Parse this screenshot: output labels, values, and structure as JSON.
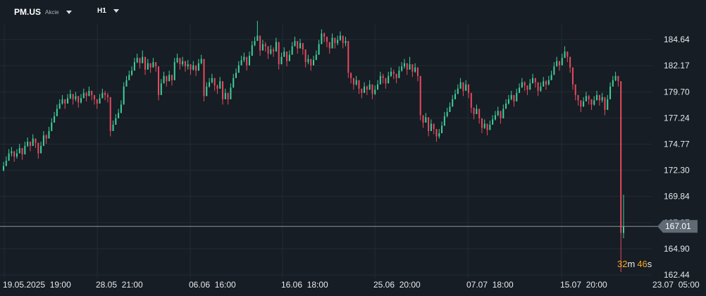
{
  "toolbar": {
    "symbol": "PM.US",
    "asset_class": "Akcie",
    "timeframe": "H1"
  },
  "countdown": {
    "minutes": "32",
    "m_unit": "m",
    "seconds": "46",
    "s_unit": "s"
  },
  "colors": {
    "background": "#161d24",
    "grid": "#222b34",
    "up_candle": "#3fcf9a",
    "down_candle": "#e8495f",
    "price_line": "#8a949e",
    "price_tag": "#606a74",
    "countdown": "#f5a623"
  },
  "chart_data": {
    "type": "candlestick",
    "y_ticks": [
      "184.64",
      "182.17",
      "179.70",
      "177.24",
      "174.77",
      "172.30",
      "169.84",
      "167.37",
      "164.90",
      "162.44"
    ],
    "y_range": [
      162.44,
      184.64
    ],
    "x_ticks": [
      "19.05.2025  19:00",
      "28.05  21:00",
      "06.06  16:00",
      "16.06  18:00",
      "25.06  20:00",
      "07.07  18:00",
      "15.07  20:00",
      "23.07  05:00"
    ],
    "current_price": "167.01",
    "grid": true,
    "closes": [
      172.7,
      173.2,
      173.9,
      174.1,
      173.6,
      173.9,
      174.4,
      173.8,
      174.6,
      175.0,
      174.6,
      175.3,
      174.9,
      173.9,
      174.6,
      175.6,
      175.3,
      176.0,
      176.8,
      177.4,
      178.1,
      178.6,
      179.0,
      178.6,
      179.1,
      179.5,
      179.0,
      179.3,
      178.7,
      179.1,
      179.6,
      179.3,
      179.8,
      179.4,
      179.0,
      178.6,
      179.1,
      179.6,
      179.4,
      179.2,
      176.0,
      176.6,
      177.2,
      177.7,
      178.5,
      180.2,
      180.8,
      181.3,
      181.7,
      182.5,
      182.9,
      182.4,
      183.0,
      181.8,
      182.4,
      182.0,
      182.5,
      182.1,
      179.4,
      180.5,
      181.2,
      180.7,
      181.3,
      180.8,
      182.5,
      182.9,
      182.3,
      182.6,
      182.1,
      182.3,
      181.8,
      182.2,
      181.7,
      182.4,
      182.8,
      179.3,
      180.2,
      180.6,
      181.0,
      180.3,
      180.0,
      180.7,
      179.0,
      179.6,
      179.0,
      180.1,
      181.0,
      181.5,
      182.2,
      182.7,
      183.0,
      182.2,
      183.1,
      184.1,
      184.5,
      185.0,
      183.6,
      184.2,
      184.0,
      183.3,
      183.7,
      183.5,
      184.4,
      182.3,
      183.0,
      183.5,
      182.6,
      183.2,
      184.0,
      184.5,
      183.8,
      184.3,
      183.7,
      182.5,
      182.8,
      182.2,
      182.7,
      183.2,
      184.2,
      185.2,
      184.9,
      184.4,
      183.8,
      184.8,
      184.3,
      184.6,
      185.0,
      184.3,
      184.5,
      181.5,
      181.0,
      180.4,
      180.8,
      180.0,
      179.6,
      180.2,
      179.9,
      180.4,
      179.5,
      179.9,
      180.4,
      181.2,
      181.0,
      180.5,
      181.2,
      181.6,
      181.4,
      181.0,
      181.7,
      182.1,
      182.4,
      181.8,
      182.3,
      181.6,
      182.0,
      181.2,
      177.5,
      176.8,
      177.3,
      176.0,
      176.7,
      176.2,
      175.5,
      175.8,
      176.5,
      177.4,
      177.8,
      178.3,
      179.0,
      179.5,
      180.0,
      180.6,
      179.8,
      180.4,
      179.6,
      178.2,
      177.6,
      178.1,
      177.2,
      176.3,
      176.7,
      176.1,
      176.6,
      177.1,
      177.5,
      177.9,
      177.2,
      178.1,
      178.6,
      179.0,
      179.4,
      178.8,
      179.6,
      180.1,
      180.6,
      180.3,
      179.9,
      180.5,
      181.0,
      180.6,
      179.8,
      180.2,
      180.7,
      180.4,
      180.8,
      181.3,
      182.1,
      182.6,
      182.2,
      182.9,
      183.5,
      183.0,
      182.0,
      180.4,
      179.4,
      178.9,
      178.3,
      178.8,
      179.3,
      179.0,
      178.5,
      178.9,
      179.4,
      178.9,
      179.2,
      178.0,
      179.0,
      180.2,
      180.8,
      181.2,
      180.7,
      166.4,
      167.0
    ],
    "highs": [
      173.1,
      173.6,
      174.3,
      174.5,
      174.0,
      174.3,
      174.8,
      174.2,
      175.0,
      175.4,
      175.0,
      175.7,
      175.3,
      174.3,
      175.0,
      176.0,
      175.7,
      176.4,
      177.2,
      177.8,
      178.5,
      179.0,
      179.4,
      179.0,
      179.5,
      179.9,
      179.4,
      179.7,
      179.1,
      179.5,
      180.0,
      179.7,
      180.2,
      179.8,
      179.4,
      179.0,
      179.5,
      180.0,
      179.8,
      179.6,
      176.4,
      177.0,
      177.6,
      178.1,
      178.9,
      180.6,
      181.2,
      181.7,
      182.1,
      182.9,
      183.3,
      182.8,
      183.6,
      182.2,
      182.8,
      182.4,
      182.9,
      182.5,
      179.8,
      180.9,
      181.6,
      181.1,
      181.7,
      181.2,
      182.9,
      183.3,
      182.7,
      183.0,
      182.5,
      182.7,
      182.2,
      182.6,
      182.1,
      182.8,
      183.2,
      179.7,
      180.6,
      181.0,
      181.4,
      180.7,
      180.4,
      181.1,
      179.4,
      180.0,
      179.4,
      180.5,
      181.4,
      181.9,
      182.6,
      183.1,
      183.4,
      182.6,
      183.5,
      184.5,
      184.9,
      186.4,
      184.0,
      184.6,
      184.4,
      183.7,
      184.1,
      183.9,
      184.8,
      182.7,
      183.4,
      183.9,
      183.0,
      183.6,
      184.4,
      184.9,
      184.2,
      184.7,
      184.1,
      182.9,
      183.2,
      182.6,
      183.1,
      183.6,
      184.6,
      185.6,
      185.3,
      184.8,
      184.2,
      185.2,
      184.7,
      185.0,
      185.4,
      184.7,
      184.9,
      181.9,
      181.4,
      180.8,
      181.2,
      180.4,
      180.0,
      180.6,
      180.3,
      180.8,
      179.9,
      180.3,
      180.8,
      181.6,
      181.4,
      180.9,
      181.6,
      182.0,
      181.8,
      181.4,
      182.1,
      182.5,
      182.8,
      182.2,
      183.0,
      182.0,
      182.4,
      181.6,
      177.9,
      177.2,
      177.7,
      176.4,
      177.1,
      176.6,
      175.9,
      176.2,
      176.9,
      177.8,
      178.2,
      178.7,
      179.4,
      179.9,
      180.4,
      181.0,
      180.2,
      180.8,
      180.0,
      178.6,
      178.0,
      178.5,
      177.6,
      176.7,
      177.1,
      176.5,
      177.0,
      177.5,
      177.9,
      178.3,
      177.6,
      178.5,
      179.0,
      179.4,
      179.8,
      179.2,
      180.0,
      180.5,
      181.0,
      180.7,
      180.3,
      180.9,
      181.4,
      181.0,
      180.2,
      180.6,
      181.1,
      180.8,
      181.2,
      181.7,
      182.5,
      183.0,
      182.6,
      183.3,
      184.0,
      183.4,
      182.4,
      180.8,
      179.8,
      179.3,
      178.7,
      179.2,
      179.7,
      179.4,
      178.9,
      179.3,
      179.8,
      179.3,
      179.6,
      178.4,
      179.4,
      180.6,
      181.2,
      181.6,
      181.1,
      168.9,
      170.0
    ],
    "lows": [
      172.2,
      172.7,
      173.4,
      173.6,
      173.1,
      173.4,
      173.9,
      173.3,
      174.1,
      174.5,
      174.1,
      174.8,
      174.4,
      173.4,
      174.1,
      175.1,
      174.8,
      175.5,
      176.3,
      176.9,
      177.6,
      178.1,
      178.5,
      178.1,
      178.6,
      179.0,
      178.5,
      178.8,
      178.2,
      178.6,
      179.1,
      178.8,
      179.3,
      178.9,
      178.5,
      178.1,
      178.6,
      179.1,
      178.9,
      178.7,
      175.5,
      176.1,
      176.7,
      177.2,
      178.0,
      179.7,
      180.3,
      180.8,
      181.2,
      182.0,
      182.4,
      181.9,
      182.5,
      181.3,
      181.9,
      181.5,
      182.0,
      181.6,
      178.9,
      180.0,
      180.7,
      180.2,
      180.8,
      180.3,
      182.0,
      182.4,
      181.8,
      182.1,
      181.6,
      181.8,
      181.3,
      181.7,
      181.2,
      181.9,
      182.3,
      178.8,
      179.7,
      180.1,
      180.5,
      179.8,
      179.5,
      180.2,
      178.5,
      179.1,
      178.5,
      179.6,
      180.5,
      181.0,
      181.7,
      182.2,
      182.5,
      181.7,
      182.6,
      183.6,
      184.0,
      184.5,
      183.1,
      183.7,
      183.5,
      182.8,
      183.2,
      183.0,
      183.9,
      181.8,
      182.5,
      183.0,
      182.1,
      182.7,
      183.5,
      184.0,
      183.3,
      183.8,
      183.2,
      182.0,
      182.3,
      181.7,
      182.2,
      182.7,
      183.7,
      184.7,
      184.4,
      183.9,
      183.3,
      184.3,
      183.8,
      184.1,
      184.5,
      183.8,
      184.0,
      181.0,
      180.5,
      179.9,
      180.3,
      179.5,
      179.1,
      179.7,
      179.4,
      179.9,
      179.0,
      179.4,
      179.9,
      180.7,
      180.5,
      180.0,
      180.7,
      181.1,
      180.9,
      180.5,
      181.2,
      181.6,
      181.9,
      181.3,
      181.8,
      181.1,
      181.5,
      180.7,
      177.0,
      176.3,
      176.8,
      175.5,
      176.2,
      175.7,
      175.0,
      175.3,
      176.0,
      176.9,
      177.3,
      177.8,
      178.5,
      179.0,
      179.5,
      180.1,
      179.3,
      179.9,
      179.1,
      177.7,
      177.1,
      177.6,
      176.7,
      175.8,
      176.2,
      175.6,
      176.1,
      176.6,
      177.0,
      177.4,
      176.7,
      177.6,
      178.1,
      178.5,
      178.9,
      178.3,
      179.1,
      179.6,
      180.1,
      179.8,
      179.4,
      180.0,
      180.5,
      180.1,
      179.3,
      179.7,
      180.2,
      179.9,
      180.3,
      180.8,
      181.6,
      182.1,
      181.7,
      182.4,
      183.0,
      182.5,
      181.5,
      179.9,
      178.9,
      178.4,
      177.8,
      178.3,
      178.8,
      178.5,
      178.0,
      178.4,
      178.9,
      178.4,
      178.7,
      177.5,
      178.5,
      179.7,
      180.3,
      180.7,
      180.2,
      162.7,
      165.9
    ]
  }
}
